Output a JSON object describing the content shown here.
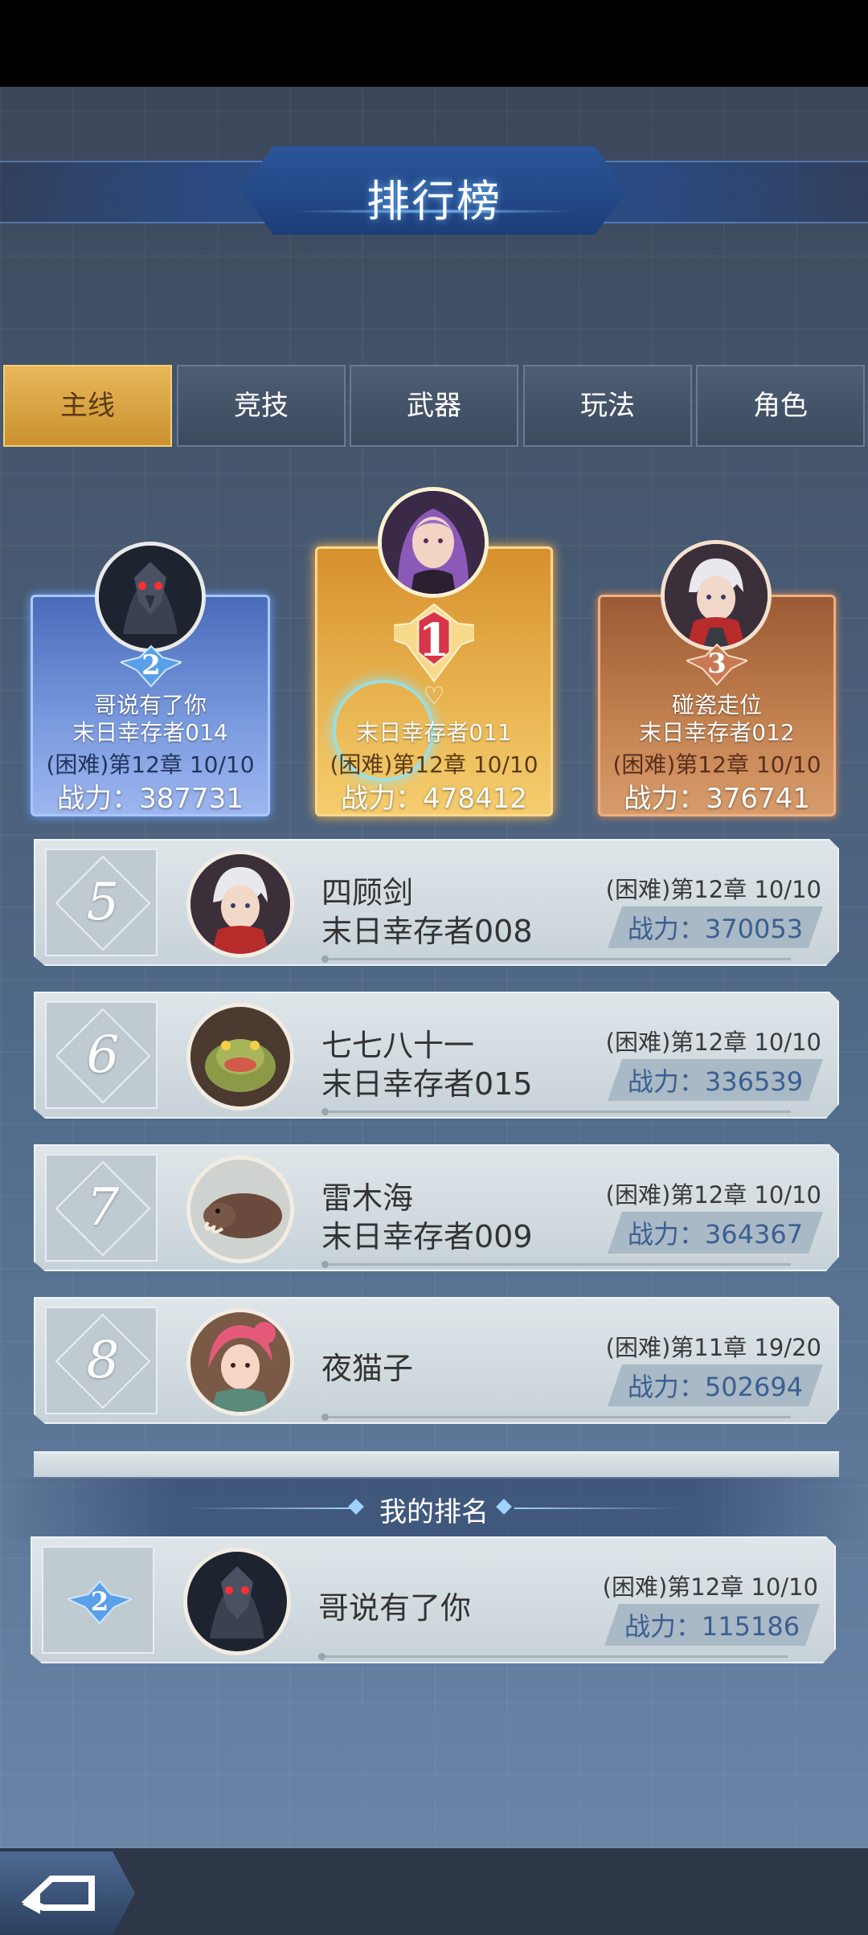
{
  "title": "排行榜",
  "tabs": [
    {
      "label": "主线",
      "active": true
    },
    {
      "label": "竞技",
      "active": false
    },
    {
      "label": "武器",
      "active": false
    },
    {
      "label": "玩法",
      "active": false
    },
    {
      "label": "角色",
      "active": false
    }
  ],
  "podium": {
    "first": {
      "rank": "1",
      "name": "末日幸存者011",
      "difficulty": "(困难)第12章 10/10",
      "power": "战力：478412"
    },
    "second": {
      "rank": "2",
      "name_line1": "哥说有了你",
      "name_line2": "末日幸存者014",
      "difficulty": "(困难)第12章 10/10",
      "power": "战力：387731"
    },
    "third": {
      "rank": "3",
      "name_line1": "碰瓷走位",
      "name_line2": "末日幸存者012",
      "difficulty": "(困难)第12章 10/10",
      "power": "战力：376741"
    }
  },
  "list": [
    {
      "rank": "5",
      "name_line1": "四顾剑",
      "name_line2": "末日幸存者008",
      "difficulty": "(困难)第12章 10/10",
      "power": "战力：370053"
    },
    {
      "rank": "6",
      "name_line1": "七七八十一",
      "name_line2": "末日幸存者015",
      "difficulty": "(困难)第12章 10/10",
      "power": "战力：336539"
    },
    {
      "rank": "7",
      "name_line1": "雷木海",
      "name_line2": "末日幸存者009",
      "difficulty": "(困难)第12章 10/10",
      "power": "战力：364367"
    },
    {
      "rank": "8",
      "name": "夜猫子",
      "difficulty": "(困难)第11章 19/20",
      "power": "战力：502694"
    }
  ],
  "my_rank": {
    "header": "我的排名",
    "rank": "2",
    "name": "哥说有了你",
    "difficulty": "(困难)第12章 10/10",
    "power": "战力：115186"
  },
  "colors": {
    "tab_active": "#e0ac4a",
    "podium_first": "#e8b34f",
    "podium_second": "#7c9ce0",
    "podium_third": "#c2804f",
    "power_text": "#3c5f92"
  },
  "icons": {
    "back": "back-arrow-icon"
  }
}
